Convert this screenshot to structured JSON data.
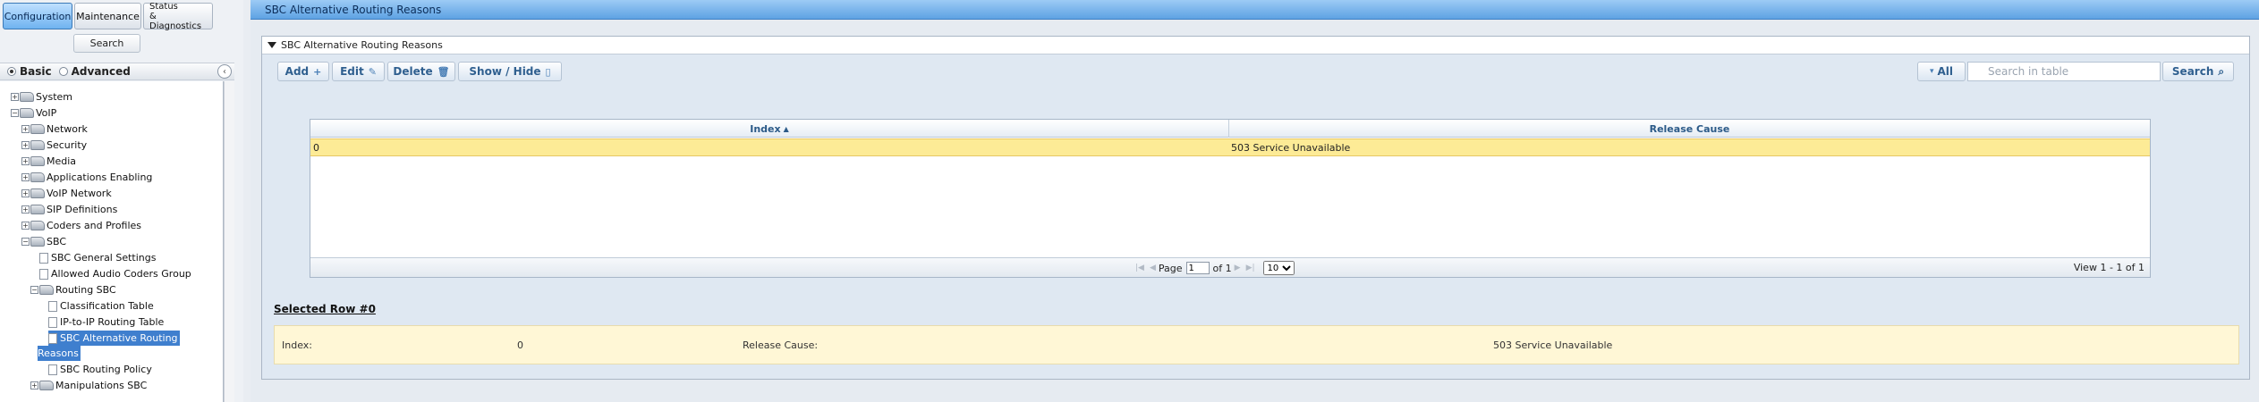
{
  "top_nav": {
    "configuration": "Configuration",
    "maintenance": "Maintenance",
    "status_line1": "Status",
    "status_line2": "& Diagnostics",
    "search": "Search"
  },
  "view_mode": {
    "basic": "Basic",
    "advanced": "Advanced"
  },
  "tree": {
    "system": "System",
    "voip": "VoIP",
    "network": "Network",
    "security": "Security",
    "media": "Media",
    "applications_enabling": "Applications Enabling",
    "voip_network": "VoIP Network",
    "sip_definitions": "SIP Definitions",
    "coders_and_profiles": "Coders and Profiles",
    "sbc": "SBC",
    "sbc_general_settings": "SBC General Settings",
    "allowed_audio_coders_group": "Allowed Audio Coders Group",
    "routing_sbc": "Routing SBC",
    "classification_table": "Classification Table",
    "ip_to_ip_routing_table": "IP-to-IP Routing Table",
    "sbc_alt_routing_line1": "SBC Alternative Routing",
    "sbc_alt_routing_line2": "Reasons",
    "sbc_routing_policy": "SBC Routing Policy",
    "manipulations_sbc": "Manipulations SBC"
  },
  "page": {
    "header_title": "SBC Alternative Routing Reasons",
    "panel_title": "SBC Alternative Routing Reasons"
  },
  "toolbar": {
    "add": "Add",
    "edit": "Edit",
    "delete": "Delete",
    "show_hide": "Show / Hide",
    "all": "All",
    "search_placeholder": "Search in table",
    "search": "Search"
  },
  "table": {
    "columns": [
      "Index",
      "Release Cause"
    ],
    "rows": [
      {
        "index": "0",
        "release_cause": "503 Service Unavailable"
      }
    ]
  },
  "pager": {
    "page_label": "Page",
    "current_page": "1",
    "of_label": "of 1",
    "page_size": "10",
    "view_info": "View 1 - 1 of 1"
  },
  "selected": {
    "title": "Selected Row #0",
    "index_label": "Index:",
    "index_value": "0",
    "release_cause_label": "Release Cause:",
    "release_cause_value": "503 Service Unavailable"
  },
  "colors": {
    "header_blue": "#5ea2e3",
    "active_tab": "#6fb3f0",
    "selected_row": "#fdeb96",
    "detail_bg": "#fff7d6",
    "tree_highlight": "#3f7fce"
  }
}
